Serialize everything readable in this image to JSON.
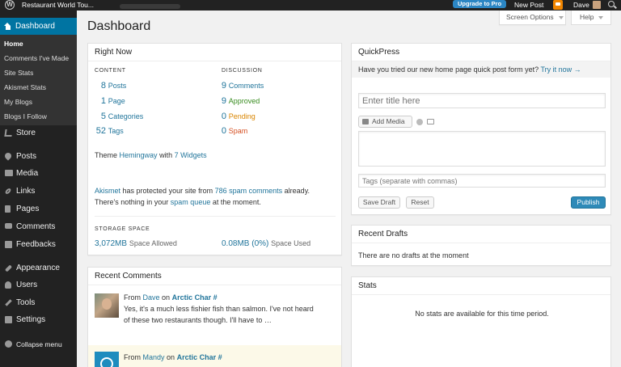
{
  "adminbar": {
    "logo_glyph": "W",
    "site_name": "Restaurant World Tou...",
    "upgrade_label": "Upgrade to Pro",
    "new_post_label": "New Post",
    "user_name": "Dave"
  },
  "sidebar": {
    "dashboard_label": "Dashboard",
    "submenu": [
      "Home",
      "Comments I've Made",
      "Site Stats",
      "Akismet Stats",
      "My Blogs",
      "Blogs I Follow"
    ],
    "items": [
      "Store",
      "Posts",
      "Media",
      "Links",
      "Pages",
      "Comments",
      "Feedbacks",
      "Appearance",
      "Users",
      "Tools",
      "Settings",
      "Collapse menu"
    ]
  },
  "header": {
    "title": "Dashboard",
    "screen_options": "Screen Options",
    "help": "Help"
  },
  "right_now": {
    "title": "Right Now",
    "content_heading": "CONTENT",
    "discussion_heading": "DISCUSSION",
    "content": [
      {
        "count": "8",
        "label": "Posts"
      },
      {
        "count": "1",
        "label": "Page"
      },
      {
        "count": "5",
        "label": "Categories"
      },
      {
        "count": "52",
        "label": "Tags"
      }
    ],
    "discussion": [
      {
        "count": "9",
        "label": "Comments"
      },
      {
        "count": "9",
        "label": "Approved"
      },
      {
        "count": "0",
        "label": "Pending"
      },
      {
        "count": "0",
        "label": "Spam"
      }
    ],
    "theme_prefix": "Theme",
    "theme_name": "Hemingway",
    "theme_with": "with",
    "widgets_link": "7 Widgets",
    "akismet_link": "Akismet",
    "akismet_text_1": "has protected your site from",
    "spam_comments_link": "786 spam comments",
    "akismet_text_2": "already.",
    "akismet_text_3": "There's nothing in your",
    "spam_queue_link": "spam queue",
    "akismet_text_4": "at the moment.",
    "storage_heading": "STORAGE SPACE",
    "space_allowed_value": "3,072MB",
    "space_allowed_label": "Space Allowed",
    "space_used_value": "0.08MB (0%)",
    "space_used_label": "Space Used"
  },
  "recent_comments": {
    "title": "Recent Comments",
    "items": [
      {
        "from": "From",
        "author": "Dave",
        "on": "on",
        "post": "Arctic Char #",
        "line1": "Yes, it's a much less fishier fish than salmon. I've not heard",
        "line2": "of these two restaurants though. I'll have to …"
      },
      {
        "from": "From",
        "author": "Mandy",
        "on": "on",
        "post": "Arctic Char #"
      }
    ]
  },
  "quickpress": {
    "title": "QuickPress",
    "banner_text": "Have you tried our new home page quick post form yet?",
    "banner_link": "Try it now →",
    "title_placeholder": "Enter title here",
    "add_media": "Add Media",
    "tags_placeholder": "Tags (separate with commas)",
    "save_draft": "Save Draft",
    "reset": "Reset",
    "publish": "Publish"
  },
  "recent_drafts": {
    "title": "Recent Drafts",
    "empty_text": "There are no drafts at the moment"
  },
  "stats": {
    "title": "Stats",
    "empty_text": "No stats are available for this time period."
  }
}
